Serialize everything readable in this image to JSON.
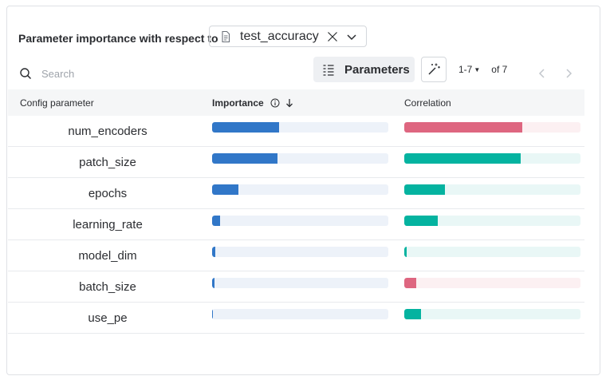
{
  "header": {
    "title": "Parameter importance with respect to",
    "metric_value": "test_accuracy"
  },
  "search": {
    "placeholder": "Search"
  },
  "toolbar": {
    "parameters_label": "Parameters",
    "pager_range": "1-7",
    "pager_total": "of 7"
  },
  "table": {
    "columns": {
      "param": "Config parameter",
      "importance": "Importance",
      "correlation": "Correlation"
    },
    "rows": [
      {
        "name": "num_encoders",
        "importance": 0.38,
        "correlation": 0.67,
        "corr_sign": "negative"
      },
      {
        "name": "patch_size",
        "importance": 0.37,
        "correlation": 0.66,
        "corr_sign": "positive"
      },
      {
        "name": "epochs",
        "importance": 0.15,
        "correlation": 0.23,
        "corr_sign": "positive"
      },
      {
        "name": "learning_rate",
        "importance": 0.045,
        "correlation": 0.19,
        "corr_sign": "positive"
      },
      {
        "name": "model_dim",
        "importance": 0.02,
        "correlation": 0.015,
        "corr_sign": "positive"
      },
      {
        "name": "batch_size",
        "importance": 0.015,
        "correlation": 0.07,
        "corr_sign": "negative"
      },
      {
        "name": "use_pe",
        "importance": 0.005,
        "correlation": 0.095,
        "corr_sign": "positive"
      }
    ]
  },
  "colors": {
    "importance_fill": "#3177c8",
    "importance_track": "#edf2f9",
    "positive_fill": "#04b3a0",
    "positive_track": "#e9f7f6",
    "negative_fill": "#de6680",
    "negative_track": "#fcf0f2"
  },
  "icons": [
    "document-icon",
    "clear-x-icon",
    "chevron-down-icon",
    "search-icon",
    "columns-list-icon",
    "magic-wand-icon",
    "info-icon",
    "sort-arrow-down-icon",
    "chevron-left-icon",
    "chevron-right-icon"
  ]
}
